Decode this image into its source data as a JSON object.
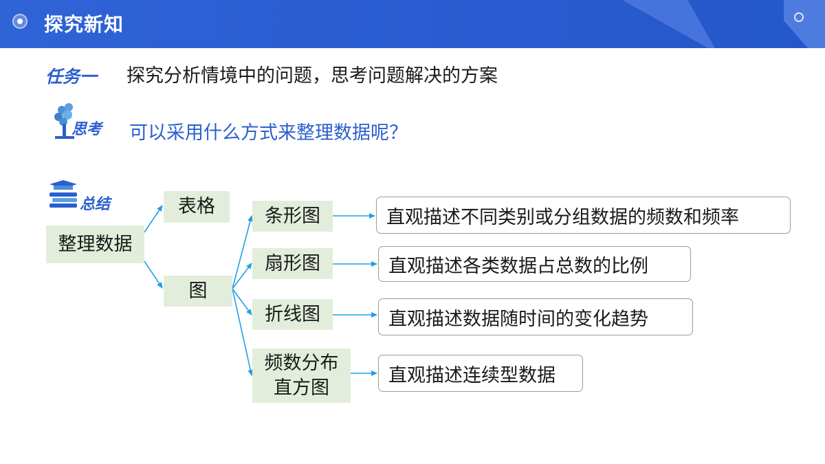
{
  "header": {
    "title": "探究新知"
  },
  "task": {
    "label": "任务一",
    "text": "探究分析情境中的问题，思考问题解决的方案"
  },
  "think": {
    "label": "思考",
    "question": "可以采用什么方式来整理数据呢？"
  },
  "summary": {
    "label": "总结"
  },
  "diagram": {
    "root": "整理数据",
    "table": "表格",
    "chart": "图",
    "types": [
      {
        "name": "条形图",
        "desc": "直观描述不同类别或分组数据的频数和频率"
      },
      {
        "name": "扇形图",
        "desc": "直观描述各类数据占总数的比例"
      },
      {
        "name": "折线图",
        "desc": "直观描述数据随时间的变化趋势"
      },
      {
        "name_line1": "频数分布",
        "name_line2": "直方图",
        "desc": "直观描述连续型数据"
      }
    ]
  },
  "colors": {
    "header": "#2f63d6",
    "accent": "#2b5fcf",
    "arrow": "#1ea0e6",
    "box_fill": "#e2eedb"
  }
}
